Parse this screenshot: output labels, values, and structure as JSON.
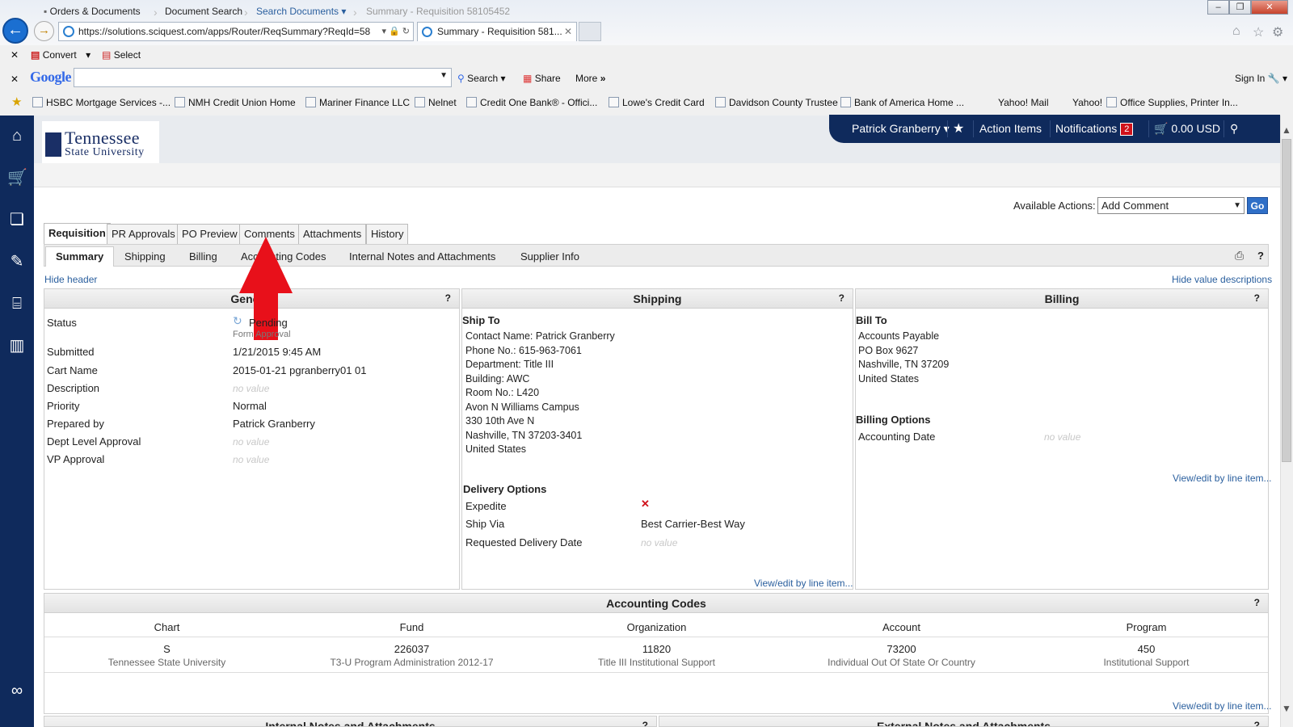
{
  "browser": {
    "url": "https://solutions.sciquest.com/apps/Router/ReqSummary?ReqId=58",
    "tab_title": "Summary - Requisition 581...",
    "toolbar1": {
      "convert": "Convert",
      "select": "Select"
    },
    "toolbar2": {
      "google": "Google",
      "search": "Search",
      "share": "Share",
      "more": "More",
      "sign_in": "Sign In"
    },
    "favorites": [
      "HSBC Mortgage Services -...",
      "NMH Credit Union Home",
      "Mariner Finance LLC",
      "Nelnet",
      "Credit One Bank® - Offici...",
      "Lowe's Credit Card",
      "Davidson County Trustee",
      "Bank of America  Home ...",
      "Yahoo! Mail",
      "Yahoo!",
      "Office Supplies, Printer In..."
    ]
  },
  "logo": {
    "line1": "Tennessee",
    "line2": "State University"
  },
  "topbar": {
    "user": "Patrick Granberry",
    "action_items": "Action Items",
    "notifications": "Notifications",
    "notif_count": "2",
    "cart": "0.00 USD"
  },
  "breadcrumb": {
    "orders": "Orders & Documents",
    "doc_search": "Document Search",
    "search_docs": "Search Documents",
    "current": "Summary - Requisition 58105452"
  },
  "actions": {
    "label": "Available Actions:",
    "selected": "Add Comment",
    "go": "Go"
  },
  "tabs": [
    "Requisition",
    "PR Approvals",
    "PO Preview",
    "Comments",
    "Attachments",
    "History"
  ],
  "subtabs": [
    "Summary",
    "Shipping",
    "Billing",
    "Accounting Codes",
    "Internal Notes and Attachments",
    "Supplier Info"
  ],
  "links": {
    "hide_header": "Hide header",
    "hide_values": "Hide value descriptions",
    "view_edit": "View/edit by line item..."
  },
  "general": {
    "title": "General",
    "rows": [
      {
        "label": "Status",
        "value": "Pending",
        "sub": "Form Approval"
      },
      {
        "label": "Submitted",
        "value": "1/21/2015 9:45 AM"
      },
      {
        "label": "Cart Name",
        "value": "2015-01-21 pgranberry01 01"
      },
      {
        "label": "Description",
        "value": "no value"
      },
      {
        "label": "Priority",
        "value": "Normal"
      },
      {
        "label": "Prepared by",
        "value": "Patrick Granberry"
      },
      {
        "label": "Dept Level Approval",
        "value": "no value"
      },
      {
        "label": "VP Approval",
        "value": "no value"
      }
    ]
  },
  "shipping": {
    "title": "Shipping",
    "ship_to": "Ship To",
    "lines": [
      "Contact Name: Patrick Granberry",
      "Phone No.: 615-963-7061",
      "Department: Title III",
      "Building: AWC",
      "Room No.: L420",
      "Avon N Williams Campus",
      "330 10th Ave N",
      "Nashville, TN 37203-3401",
      "United States"
    ],
    "delivery_title": "Delivery Options",
    "expedite": "Expedite",
    "expedite_mark": "✕",
    "ship_via": "Ship Via",
    "ship_via_value": "Best Carrier-Best Way",
    "req_date": "Requested Delivery Date",
    "req_date_value": "no value"
  },
  "billing": {
    "title": "Billing",
    "bill_to": "Bill To",
    "lines": [
      "Accounts Payable",
      "PO Box 9627",
      "Nashville, TN 37209",
      "United States"
    ],
    "options_title": "Billing Options",
    "acct_date": "Accounting Date",
    "acct_date_value": "no value"
  },
  "accounting": {
    "title": "Accounting Codes",
    "columns": [
      {
        "head": "Chart",
        "value": "S",
        "desc": "Tennessee State University"
      },
      {
        "head": "Fund",
        "value": "226037",
        "desc": "T3-U Program Administration 2012-17"
      },
      {
        "head": "Organization",
        "value": "11820",
        "desc": "Title III Institutional Support"
      },
      {
        "head": "Account",
        "value": "73200",
        "desc": "Individual Out Of State Or Country"
      },
      {
        "head": "Program",
        "value": "450",
        "desc": "Institutional Support"
      }
    ]
  },
  "bottom": {
    "internal": "Internal Notes and Attachments",
    "external": "External Notes and Attachments"
  },
  "q": "?",
  "colors": {
    "nav": "#0f2a5c",
    "link": "#2a5f9e",
    "arrow": "#e8101a",
    "badge": "#d0121b"
  }
}
